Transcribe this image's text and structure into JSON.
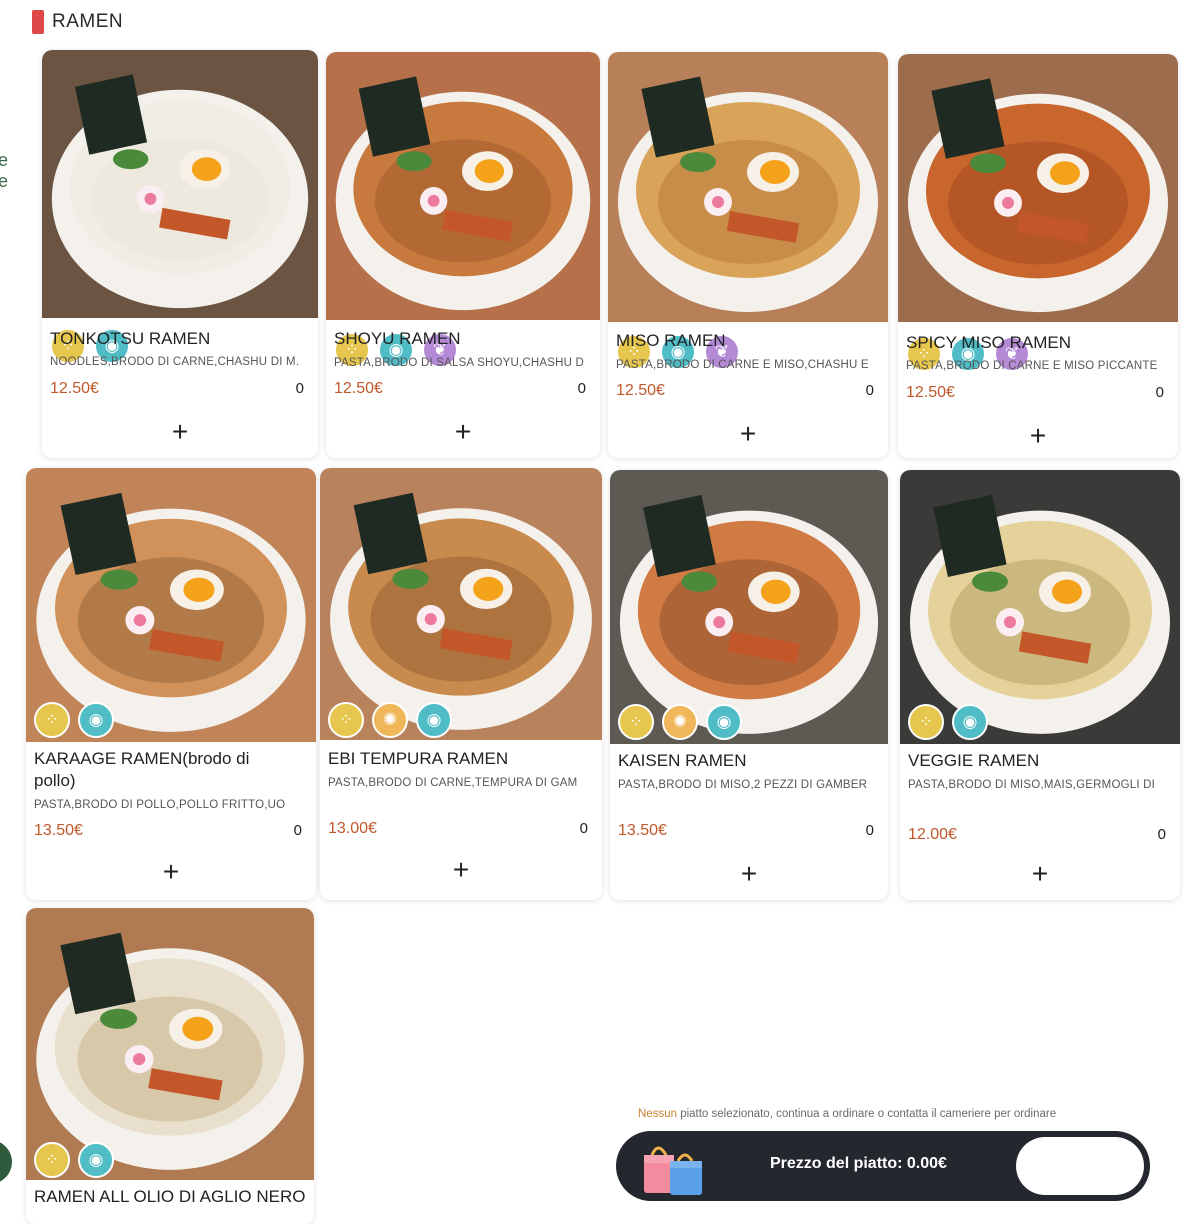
{
  "section": {
    "title": "RAMEN",
    "accent_color": "#e04848"
  },
  "items": [
    {
      "name": "TONKOTSU RAMEN",
      "desc": "NOODLES,BRODO DI CARNE,CHASHU DI M.",
      "price": "12.50€",
      "qty": "0",
      "add": "+",
      "badges": [
        "wheat",
        "soy"
      ]
    },
    {
      "name": "SHOYU RAMEN",
      "desc": "PASTA,BRODO DI SALSA SHOYU,CHASHU D",
      "price": "12.50€",
      "qty": "0",
      "add": "+",
      "badges": [
        "wheat",
        "soy",
        "sesame"
      ]
    },
    {
      "name": "MISO RAMEN",
      "desc": "PASTA,BRODO DI CARNE E MISO,CHASHU E",
      "price": "12.50€",
      "qty": "0",
      "add": "+",
      "badges": [
        "wheat",
        "soy",
        "sesame"
      ]
    },
    {
      "name": "SPICY MISO RAMEN",
      "desc": "PASTA,BRODO DI CARNE E MISO PICCANTE",
      "price": "12.50€",
      "qty": "0",
      "add": "+",
      "badges": [
        "wheat",
        "soy",
        "sesame"
      ]
    },
    {
      "name": "KARAAGE RAMEN(brodo di pollo)",
      "desc": "PASTA,BRODO DI POLLO,POLLO FRITTO,UO",
      "price": "13.50€",
      "qty": "0",
      "add": "+",
      "badges": [
        "wheat",
        "soy"
      ]
    },
    {
      "name": "EBI TEMPURA RAMEN",
      "desc": "PASTA,BRODO DI CARNE,TEMPURA DI GAM",
      "price": "13.00€",
      "qty": "0",
      "add": "+",
      "badges": [
        "wheat",
        "shellfish",
        "soy"
      ]
    },
    {
      "name": "KAISEN RAMEN",
      "desc": "PASTA,BRODO DI MISO,2 PEZZI DI GAMBER",
      "price": "13.50€",
      "qty": "0",
      "add": "+",
      "badges": [
        "wheat",
        "shellfish",
        "soy"
      ]
    },
    {
      "name": "VEGGIE RAMEN",
      "desc": "PASTA,BRODO DI MISO,MAIS,GERMOGLI DI",
      "price": "12.00€",
      "qty": "0",
      "add": "+",
      "badges": [
        "wheat",
        "soy"
      ]
    },
    {
      "name": "RAMEN ALL OLIO DI AGLIO NERO",
      "desc": "",
      "price": "",
      "qty": "",
      "add": "",
      "badges": [
        "wheat",
        "soy"
      ]
    }
  ],
  "footer": {
    "notice": "Nessun piatto selezionato, continua a ordinare o contatta il cameriere per ordinare",
    "price_label": "Prezzo del piatto: 0.00€"
  },
  "icons": {
    "wheat": "wheat-icon",
    "soy": "soy-icon",
    "sesame": "sesame-icon",
    "shellfish": "shellfish-icon",
    "add": "plus-icon",
    "cart": "shopping-bags-icon"
  },
  "colors": {
    "price": "#c0582a",
    "cart_bar": "#24282e"
  }
}
